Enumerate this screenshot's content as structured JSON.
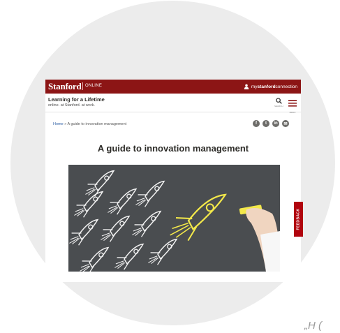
{
  "header": {
    "logo": "Stanford",
    "logo_sub": "ONLINE",
    "account_prefix": "my",
    "account_brand": "stanford",
    "account_suffix": "connection"
  },
  "tagline": {
    "line1": "Learning for a Lifetime",
    "line2": "online. at Stanford. at work."
  },
  "icons": {
    "search_label": "SEARCH",
    "menu_label": "MENU"
  },
  "breadcrumb": {
    "home": "Home",
    "separator": "»",
    "current": "A guide to innovation management"
  },
  "social": [
    "f",
    "t",
    "in",
    "✉"
  ],
  "article": {
    "title": "A guide to innovation management"
  },
  "feedback": "FEEDBACK",
  "corner_text": "„H ("
}
